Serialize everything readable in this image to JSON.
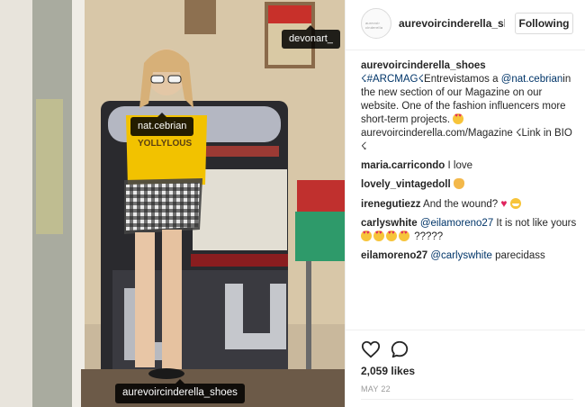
{
  "photo": {
    "tags": {
      "devonart": "devonart_",
      "natcebrian": "nat.cebrian",
      "aurevoir": "aurevoircinderella_shoes"
    },
    "shirt_text": "YOLLYLOUS"
  },
  "header": {
    "avatar_text": "aurevoir cinderella",
    "username": "aurevoircinderella_sho",
    "follow_label": "Following"
  },
  "caption": {
    "user": "aurevoircinderella_shoes",
    "hashtag": "☇#ARCMAG☇",
    "text1": "Entrevistamos a ",
    "mention": "@nat.cebrian",
    "text2": "in the new section of our Magazine on our website. One of the fashion influencers more short-term projects. ",
    "text3": " aurevoircinderella.com/Magazine ☇Link in BIO ☇"
  },
  "comments": [
    {
      "user": "maria.carricondo",
      "text": " I love"
    },
    {
      "user": "lovely_vintagedoll",
      "text": " "
    },
    {
      "user": "irenegutiezz",
      "text": " And the wound? "
    },
    {
      "user": "carlyswhite",
      "mention": "@eilamoreno27",
      "text": " It is not like yours ",
      "text2": " ?????"
    },
    {
      "user": "eilamoreno27",
      "mention": "@carlyswhite",
      "text": " parecidass"
    }
  ],
  "footer": {
    "likes": "2,059 likes",
    "date": "MAY 22"
  },
  "colors": {
    "link": "#003569",
    "heart": "#e0245e",
    "shirt": "#f2c200"
  }
}
